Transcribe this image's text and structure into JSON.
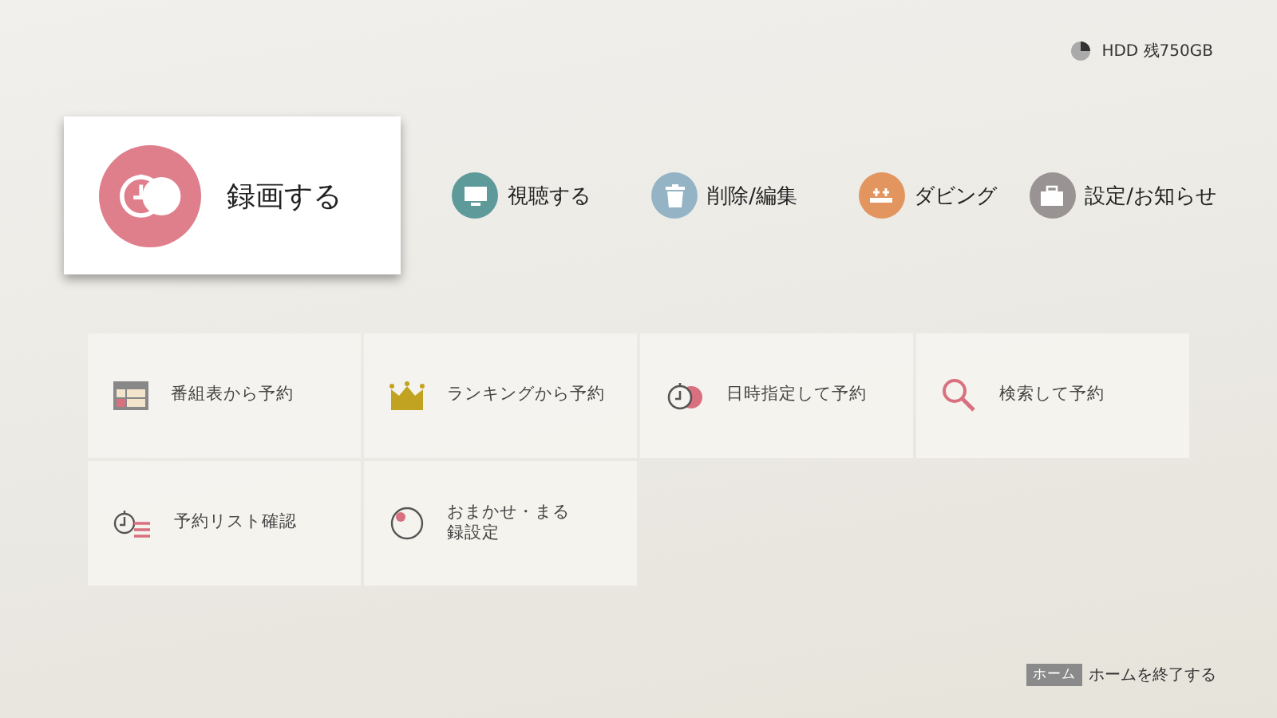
{
  "storage": {
    "label": "HDD 残750GB"
  },
  "menu": [
    {
      "label": "録画する",
      "kind": "record",
      "color": "#e07f8c",
      "selected": true
    },
    {
      "label": "視聴する",
      "kind": "tv",
      "color": "#5f9a9a",
      "selected": false
    },
    {
      "label": "削除/編集",
      "kind": "trash",
      "color": "#94b4c6",
      "selected": false
    },
    {
      "label": "ダビング",
      "kind": "dubbing",
      "color": "#e3955f",
      "selected": false
    },
    {
      "label": "設定/お知らせ",
      "kind": "toolbox",
      "color": "#9a9393",
      "selected": false
    }
  ],
  "tiles": [
    {
      "label": "番組表から予約",
      "kind": "guide"
    },
    {
      "label": "ランキングから予約",
      "kind": "crown"
    },
    {
      "label": "日時指定して予約",
      "kind": "timer"
    },
    {
      "label": "検索して予約",
      "kind": "search"
    },
    {
      "label": "予約リスト確認",
      "kind": "list"
    },
    {
      "label": "おまかせ・まる録設定",
      "kind": "auto"
    }
  ],
  "footer": {
    "key": "ホーム",
    "text": "ホームを終了する"
  }
}
